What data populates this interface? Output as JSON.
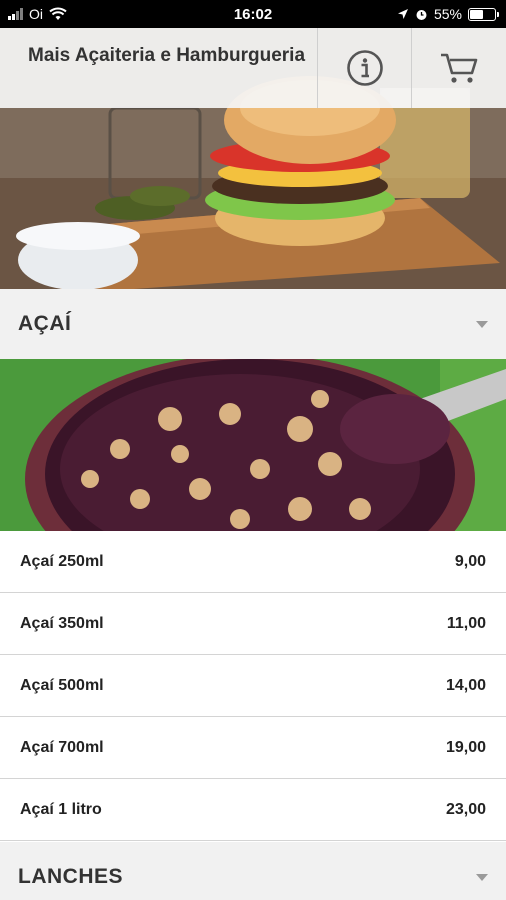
{
  "status_bar": {
    "carrier": "Oi",
    "time": "16:02",
    "battery": "55%",
    "battery_level": 0.55
  },
  "header": {
    "title": "Mais Açaiteria e Hamburgueria",
    "info_icon": "info-icon",
    "cart_icon": "cart-icon"
  },
  "sections": [
    {
      "title": "AÇAÍ",
      "items": [
        {
          "name": "Açaí 250ml",
          "price": "9,00"
        },
        {
          "name": "Açaí 350ml",
          "price": "11,00"
        },
        {
          "name": "Açaí 500ml",
          "price": "14,00"
        },
        {
          "name": "Açaí 700ml",
          "price": "19,00"
        },
        {
          "name": "Açaí 1 litro",
          "price": "23,00"
        }
      ]
    },
    {
      "title": "LANCHES"
    }
  ]
}
